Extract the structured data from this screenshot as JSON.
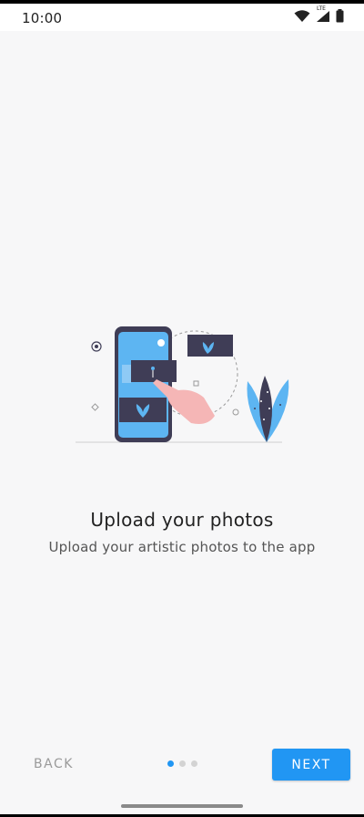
{
  "status_bar": {
    "time": "10:00",
    "network_label": "LTE",
    "icons": [
      "wifi-icon",
      "cell-signal-icon",
      "battery-icon"
    ]
  },
  "onboarding": {
    "title": "Upload your photos",
    "subtitle": "Upload your artistic photos to the app",
    "page_index": 1,
    "page_count": 3
  },
  "navigation": {
    "back_label": "BACK",
    "next_label": "NEXT"
  },
  "colors": {
    "accent": "#2196f3",
    "dot_inactive": "#d3d3d3",
    "illustration_dark": "#3f3d56",
    "illustration_blue": "#5db5f2",
    "illustration_pink": "#f5b6b6"
  }
}
